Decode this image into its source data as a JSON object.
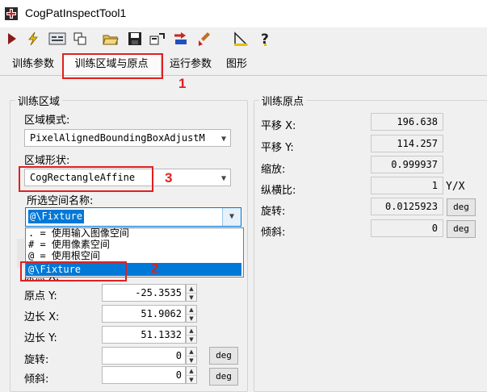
{
  "window": {
    "title": "CogPatInspectTool1"
  },
  "toolbar": {
    "icons": [
      "run-icon",
      "electric-run-icon",
      "image-display-icon",
      "graphics-icon",
      "open-icon",
      "save-icon",
      "reset-icon",
      "import-icon",
      "clear-icon",
      "ruler-icon",
      "help-icon"
    ]
  },
  "tabs": [
    {
      "label": "训练参数"
    },
    {
      "label": "训练区域与原点"
    },
    {
      "label": "运行参数"
    },
    {
      "label": "图形"
    }
  ],
  "annotations": {
    "n1": "1",
    "n2": "2",
    "n3": "3"
  },
  "train_region": {
    "title": "训练区域",
    "mode_label": "区域模式:",
    "mode_value": "PixelAlignedBoundingBoxAdjustM",
    "shape_label": "区域形状:",
    "shape_value": "CogRectangleAffine",
    "space_label": "所选空间名称:",
    "space_value": "@\\Fixture",
    "dropdown_items": [
      ". = 使用输入图像空间",
      "# = 使用像素空间",
      "@ = 使用根空间",
      "@\\Fixture"
    ],
    "origin_x_label": "原点 X:",
    "origin_y_label": "原点 Y:",
    "origin_y": "-25.3535",
    "side_x_label": "边长 X:",
    "side_x": "51.9062",
    "side_y_label": "边长 Y:",
    "side_y": "51.1332",
    "rotation_label": "旋转:",
    "rotation": "0",
    "skew_label": "倾斜:",
    "skew": "0",
    "deg": "deg"
  },
  "train_origin": {
    "title": "训练原点",
    "translate_x_label": "平移 X:",
    "translate_x": "196.638",
    "translate_y_label": "平移 Y:",
    "translate_y": "114.257",
    "scale_label": "缩放:",
    "scale": "0.999937",
    "aspect_label": "纵横比:",
    "aspect": "1",
    "aspect_unit": "Y/X",
    "rotation_label": "旋转:",
    "rotation": "0.0125923",
    "skew_label": "倾斜:",
    "skew": "0",
    "deg": "deg"
  },
  "colors": {
    "accent": "#0078d7",
    "highlight": "#e02020"
  }
}
